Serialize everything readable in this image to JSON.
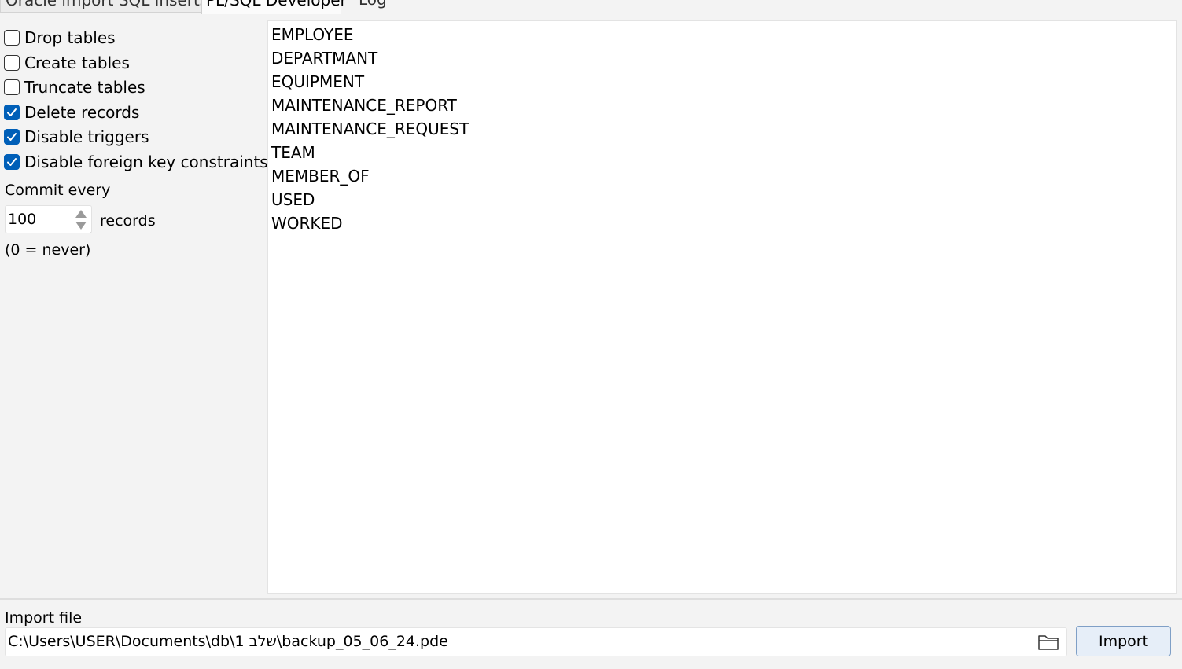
{
  "tabs": [
    {
      "label": "Oracle import  SQL inserts"
    },
    {
      "label": "PL/SQL Developer"
    },
    {
      "label": "Log"
    }
  ],
  "options": {
    "checkboxes": [
      {
        "label": "Drop tables",
        "checked": false
      },
      {
        "label": "Create tables",
        "checked": false
      },
      {
        "label": "Truncate tables",
        "checked": false
      },
      {
        "label": "Delete records",
        "checked": true
      },
      {
        "label": "Disable triggers",
        "checked": true
      },
      {
        "label": "Disable foreign key constraints",
        "checked": true
      }
    ],
    "commit_label": "Commit every",
    "commit_value": "100",
    "records_label": "records",
    "never_note": "(0 = never)"
  },
  "tables": [
    "EMPLOYEE",
    "DEPARTMANT",
    "EQUIPMENT",
    "MAINTENANCE_REPORT",
    "MAINTENANCE_REQUEST",
    "TEAM",
    "MEMBER_OF",
    "USED",
    "WORKED"
  ],
  "import": {
    "label": "Import file",
    "path": "C:\\Users\\USER\\Documents\\db\\1 שלב\\backup_05_06_24.pde",
    "button_label": "Import"
  },
  "colors": {
    "checkbox_checked": "#005fb8",
    "button_bg": "#e6eef8",
    "button_border": "#7f9fc6"
  },
  "icons": {
    "folder": "folder-open-icon",
    "spin_up": "triangle-up-icon",
    "spin_down": "triangle-down-icon",
    "check": "checkmark-icon"
  }
}
